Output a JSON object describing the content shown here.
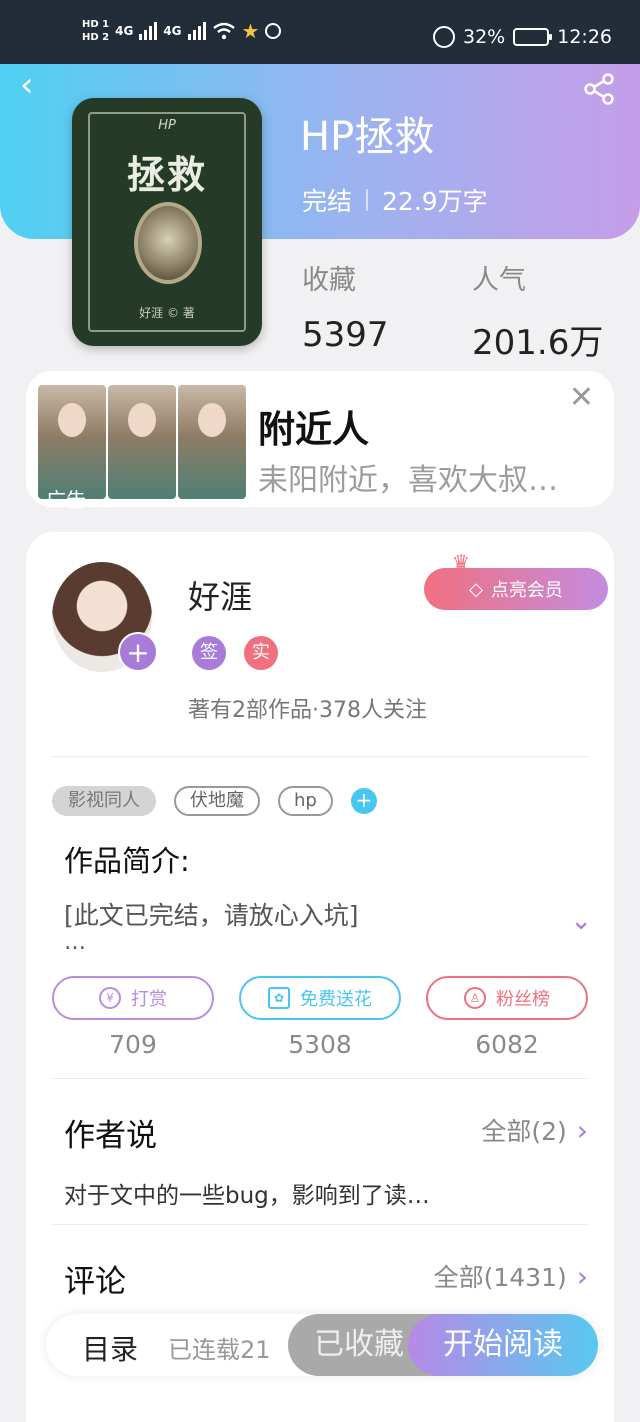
{
  "status_bar": {
    "hd1": "HD 1",
    "hd2": "HD 2",
    "net1": "4G",
    "net2": "4G",
    "battery": "32%",
    "time": "12:26"
  },
  "book": {
    "title": "HP拯救",
    "status": "完结",
    "words": "22.9万字",
    "favorites_label": "收藏",
    "favorites": "5397",
    "popularity_label": "人气",
    "popularity": "201.6万",
    "cover_hp": "HP",
    "cover_title": "拯救",
    "cover_author": "好涯 © 著"
  },
  "ad": {
    "title": "附近人",
    "desc": "耒阳附近，喜欢大叔…",
    "tag": "广告"
  },
  "author": {
    "name": "好涯",
    "badge1": "签",
    "badge2": "实",
    "info": "著有2部作品·378人关注",
    "vip_label": "点亮会员"
  },
  "tags": [
    "影视同人",
    "伏地魔",
    "hp"
  ],
  "intro": {
    "heading": "作品简介:",
    "text": "[此文已完结，请放心入坑]",
    "more": "…"
  },
  "actions": [
    {
      "label": "打赏",
      "count": "709",
      "color": "#b98ce0"
    },
    {
      "label": "免费送花",
      "count": "5308",
      "color": "#49c6ef"
    },
    {
      "label": "粉丝榜",
      "count": "6082",
      "color": "#f07080"
    }
  ],
  "author_says": {
    "heading": "作者说",
    "link": "全部(2)",
    "text": "对于文中的一些bug，影响到了读…"
  },
  "comments": {
    "heading": "评论",
    "link": "全部(1431)"
  },
  "bottom_bar": {
    "toc": "目录",
    "serial": "已连载21",
    "favorited": "已收藏",
    "read": "开始阅读"
  },
  "colors": {
    "accent_purple": "#a97bd9",
    "accent_blue": "#49c6ef",
    "accent_red": "#f07080"
  }
}
